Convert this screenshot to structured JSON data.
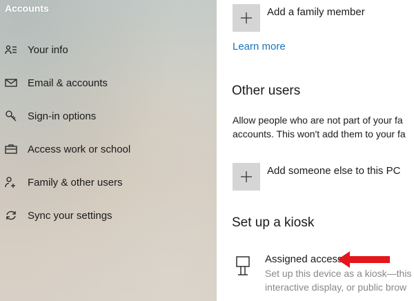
{
  "sidebar": {
    "title": "Accounts",
    "items": [
      {
        "label": "Your info",
        "icon": "person-list-icon"
      },
      {
        "label": "Email & accounts",
        "icon": "mail-icon"
      },
      {
        "label": "Sign-in options",
        "icon": "key-icon"
      },
      {
        "label": "Access work or school",
        "icon": "briefcase-icon"
      },
      {
        "label": "Family & other users",
        "icon": "people-add-icon"
      },
      {
        "label": "Sync your settings",
        "icon": "sync-icon"
      }
    ]
  },
  "main": {
    "add_family_label": "Add a family member",
    "learn_more": "Learn more",
    "other_users_title": "Other users",
    "other_users_desc_line1": "Allow people who are not part of your fa",
    "other_users_desc_line2": "accounts. This won't add them to your fa",
    "add_someone_label": "Add someone else to this PC",
    "kiosk_title": "Set up a kiosk",
    "assigned_access_title": "Assigned access",
    "assigned_access_desc_line1": "Set up this device as a kiosk—this",
    "assigned_access_desc_line2": "interactive display, or public brow"
  },
  "colors": {
    "link": "#1a73b8",
    "annotation_arrow": "#e3161b",
    "tile_bg": "#d5d5d5"
  }
}
